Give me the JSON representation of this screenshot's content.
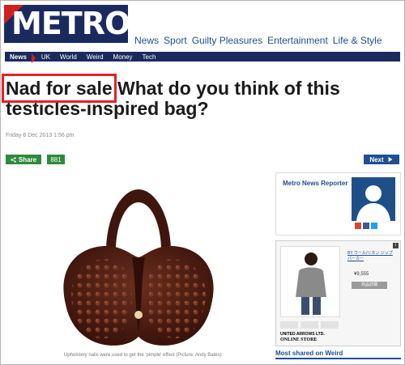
{
  "logo": {
    "text": "METRO"
  },
  "topnav": [
    "News",
    "Sport",
    "Guilty Pleasures",
    "Entertainment",
    "Life & Style"
  ],
  "subnav": {
    "active": "News",
    "items": [
      "UK",
      "World",
      "Weird",
      "Money",
      "Tech"
    ]
  },
  "article": {
    "headline_highlight": "Nad for sale",
    "headline_rest": " What do you think of this testicles-inspired bag?",
    "date": "Friday 6 Dec 2013 1:56 pm",
    "caption": "Upholstery nails were used to get the 'pimple' effect (Picture: Andy Bates)"
  },
  "share": {
    "label": "Share",
    "count": "881"
  },
  "next": {
    "label": "Next"
  },
  "sidebar": {
    "reporter": "Metro News Reporter",
    "ad": {
      "badge": "i",
      "title": "BY ウール/リネン ジップ パーカー",
      "price": "¥9,555",
      "cart": "商品詳細",
      "brand1": "UNITED ARROWS LTD.",
      "brand2": "ONLINE STORE"
    },
    "most_shared": "Most shared on Weird"
  },
  "colors": {
    "brand_navy": "#1b2a5e",
    "brand_red": "#d0201e",
    "share_green": "#2d8a3b",
    "link_blue": "#1d4f91",
    "highlight": "#e32226"
  }
}
